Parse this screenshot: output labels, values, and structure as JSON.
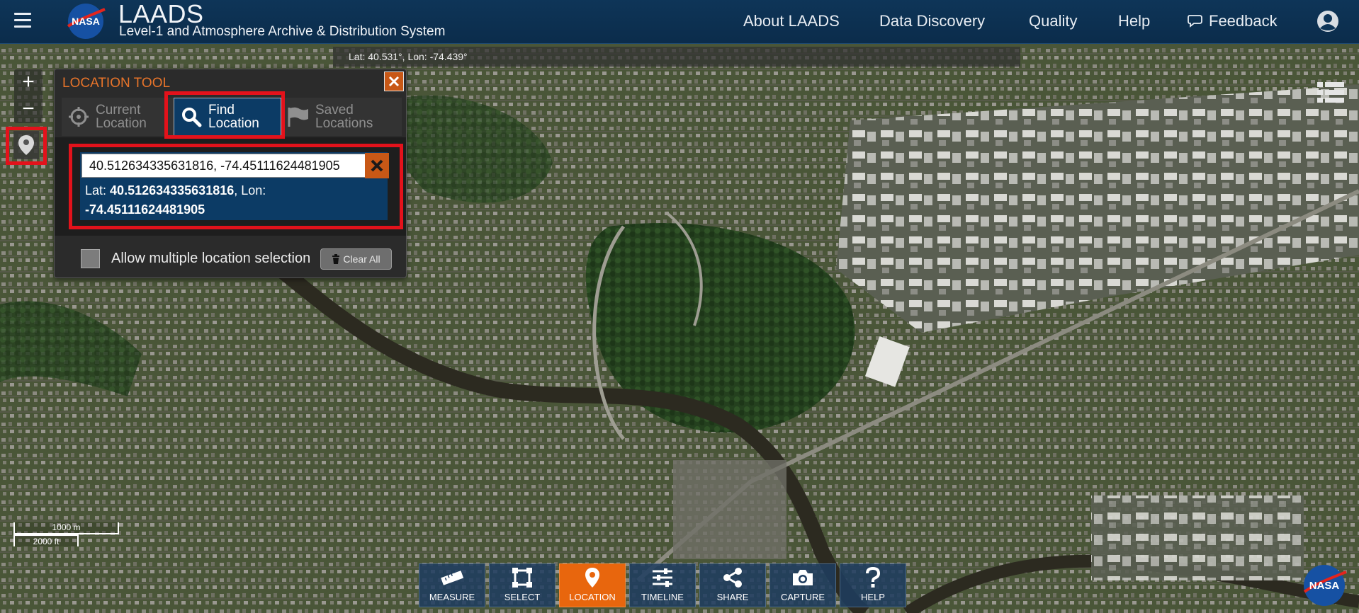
{
  "header": {
    "menu_icon": "hamburger-icon",
    "logo_text": "NASA",
    "title": "LAADS",
    "subtitle": "Level-1 and Atmosphere Archive & Distribution System",
    "nav": {
      "about": "About LAADS",
      "discovery": "Data Discovery",
      "quality": "Quality",
      "help": "Help",
      "feedback": "Feedback"
    }
  },
  "coord_bar": {
    "text": "Lat: 40.531°, Lon: -74.439°"
  },
  "map_controls": {
    "zoom_in": "+",
    "zoom_out": "−"
  },
  "location_tool": {
    "title": "LOCATION TOOL",
    "tabs": {
      "current": "Current Location",
      "find": "Find Location",
      "saved": "Saved Locations"
    },
    "search_value": "40.512634335631816, -74.45111624481905",
    "result": {
      "lat_label": "Lat:",
      "lat_value": "40.512634335631816",
      "lon_label": ", Lon:",
      "lon_value": "-74.45111624481905"
    },
    "multi_select_label": "Allow multiple location selection",
    "clear_all": "Clear All"
  },
  "scale": {
    "metric": "1000 m",
    "imperial": "2000 ft"
  },
  "toolbar": {
    "measure": "MEASURE",
    "select": "SELECT",
    "location": "LOCATION",
    "timeline": "TIMELINE",
    "share": "SHARE",
    "capture": "CAPTURE",
    "help": "HELP"
  },
  "colors": {
    "header_bg": "#0e3558",
    "accent_orange": "#e8660d",
    "highlight_red": "#e3121b",
    "panel_blue": "#0c3b65"
  }
}
